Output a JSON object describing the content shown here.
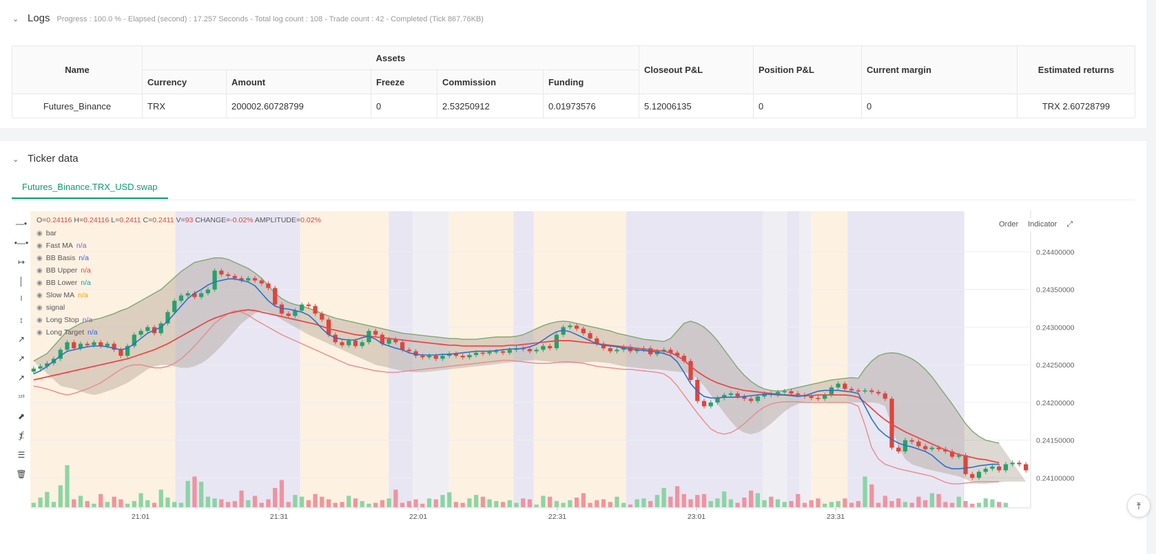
{
  "logs": {
    "title": "Logs",
    "progress": "Progress : 100.0 % - Elapsed (second) : 17.257  Seconds - Total log count : 108 - Trade count : 42 - Completed (Tick 867.76KB)"
  },
  "assets_table": {
    "headers": {
      "name": "Name",
      "assets": "Assets",
      "currency": "Currency",
      "amount": "Amount",
      "freeze": "Freeze",
      "commission": "Commission",
      "funding": "Funding",
      "closeout": "Closeout P&L",
      "position": "Position P&L",
      "margin": "Current margin",
      "returns": "Estimated returns"
    },
    "row": {
      "name": "Futures_Binance",
      "currency": "TRX",
      "amount": "200002.60728799",
      "freeze": "0",
      "commission": "2.53250912",
      "funding": "0.01973576",
      "closeout": "5.12006135",
      "position": "0",
      "margin": "0",
      "returns": "TRX 2.60728799"
    }
  },
  "ticker": {
    "title": "Ticker data",
    "tab": "Futures_Binance.TRX_USD.swap",
    "order_label": "Order",
    "indicator_label": "Indicator"
  },
  "legend": {
    "o_label": "O=",
    "o_val": "0.24116",
    "h_label": "H=",
    "h_val": "0.24116",
    "l_label": "L=",
    "l_val": "0.2411",
    "c_label": "C=",
    "c_val": "0.2411",
    "v_label": "V=",
    "v_val": "93",
    "chg_label": "CHANGE=",
    "chg_val": "-0.02%",
    "amp_label": "AMPLITUDE=",
    "amp_val": "0.02%",
    "items": [
      {
        "name": "bar",
        "value": "",
        "color": "#555"
      },
      {
        "name": "Fast MA",
        "value": "n/a",
        "color": "#7b61c9"
      },
      {
        "name": "BB Basis",
        "value": "n/a",
        "color": "#2962ff"
      },
      {
        "name": "BB Upper",
        "value": "n/a",
        "color": "#e0443c"
      },
      {
        "name": "BB Lower",
        "value": "n/a",
        "color": "#0aa59c"
      },
      {
        "name": "Slow MA",
        "value": "n/a",
        "color": "#f2a100"
      },
      {
        "name": "signal",
        "value": "",
        "color": "#555"
      },
      {
        "name": "Long Stop",
        "value": "n/a",
        "color": "#7b61c9"
      },
      {
        "name": "Long Target",
        "value": "n/a",
        "color": "#2962ff"
      }
    ]
  },
  "chart_data": {
    "type": "candlestick",
    "x_ticks": [
      "21:01",
      "21:31",
      "22:01",
      "22:31",
      "23:01",
      "23:31"
    ],
    "y_ticks": [
      "0.24400000",
      "0.24350000",
      "0.24300000",
      "0.24250000",
      "0.24200000",
      "0.24150000",
      "0.24100000"
    ],
    "y_tick_values": [
      0.244,
      0.2435,
      0.243,
      0.2425,
      0.242,
      0.2415,
      0.241
    ],
    "ylim": [
      0.24061,
      0.24452
    ],
    "colors": {
      "up": "#26a269",
      "down": "#e0443c",
      "fast_ma": "#2970c9",
      "slow_ma": "#e84848",
      "bb_upper": "#7fa86b",
      "bb_lower": "#e88a8a",
      "bb_fill": "#9e8f7e"
    },
    "close": [
      0.24245,
      0.24248,
      0.24252,
      0.24258,
      0.2427,
      0.2428,
      0.24272,
      0.24278,
      0.24276,
      0.2428,
      0.24275,
      0.24278,
      0.2427,
      0.24262,
      0.24275,
      0.2429,
      0.24295,
      0.243,
      0.24292,
      0.24305,
      0.2432,
      0.24335,
      0.24342,
      0.24345,
      0.2434,
      0.24345,
      0.2435,
      0.24375,
      0.2437,
      0.24368,
      0.24365,
      0.24362,
      0.24365,
      0.24362,
      0.24358,
      0.24352,
      0.2433,
      0.24318,
      0.24315,
      0.24322,
      0.2433,
      0.24328,
      0.24318,
      0.2431,
      0.2429,
      0.2428,
      0.24276,
      0.24282,
      0.24275,
      0.2428,
      0.24295,
      0.2429,
      0.24278,
      0.24284,
      0.2428,
      0.2427,
      0.24268,
      0.24262,
      0.2426,
      0.24262,
      0.24258,
      0.24262,
      0.24265,
      0.24262,
      0.2426,
      0.24263,
      0.24266,
      0.24265,
      0.24267,
      0.24268,
      0.24266,
      0.2427,
      0.24272,
      0.24271,
      0.24268,
      0.2427,
      0.24275,
      0.24272,
      0.2429,
      0.243,
      0.24302,
      0.24298,
      0.24292,
      0.24285,
      0.24278,
      0.24272,
      0.24268,
      0.2427,
      0.24274,
      0.24268,
      0.2427,
      0.24272,
      0.24264,
      0.24268,
      0.2427,
      0.24266,
      0.24262,
      0.24255,
      0.2423,
      0.24202,
      0.24195,
      0.242,
      0.24206,
      0.2421,
      0.24212,
      0.24208,
      0.24205,
      0.24202,
      0.24208,
      0.24212,
      0.2421,
      0.24214,
      0.24215,
      0.24212,
      0.2421,
      0.24208,
      0.24206,
      0.24205,
      0.2421,
      0.2422,
      0.24225,
      0.24218,
      0.24216,
      0.24215,
      0.24216,
      0.24214,
      0.24212,
      0.24205,
      0.2414,
      0.24135,
      0.2415,
      0.24148,
      0.24142,
      0.24138,
      0.2414,
      0.24138,
      0.24135,
      0.24128,
      0.2413,
      0.24105,
      0.241,
      0.24108,
      0.24112,
      0.24115,
      0.2411,
      0.24118,
      0.2412,
      0.24118,
      0.2411
    ],
    "fast_ma": [
      0.24238,
      0.24242,
      0.24248,
      0.24255,
      0.24262,
      0.24268,
      0.2427,
      0.24272,
      0.24274,
      0.24275,
      0.24275,
      0.24274,
      0.24272,
      0.2427,
      0.24272,
      0.24278,
      0.24285,
      0.24292,
      0.24296,
      0.243,
      0.24308,
      0.24318,
      0.24328,
      0.24338,
      0.24345,
      0.2435,
      0.24356,
      0.2436,
      0.24362,
      0.24364,
      0.24364,
      0.24362,
      0.2436,
      0.24355,
      0.24345,
      0.24335,
      0.24328,
      0.24325,
      0.24324,
      0.24322,
      0.2432,
      0.24316,
      0.24308,
      0.24298,
      0.2429,
      0.24286,
      0.24284,
      0.24283,
      0.24283,
      0.24286,
      0.24288,
      0.24284,
      0.24278,
      0.24275,
      0.24272,
      0.2427,
      0.24266,
      0.24264,
      0.24263,
      0.24263,
      0.24263,
      0.24264,
      0.24264,
      0.24265,
      0.24266,
      0.24267,
      0.24268,
      0.24268,
      0.24268,
      0.24269,
      0.2427,
      0.24271,
      0.24271,
      0.24272,
      0.24274,
      0.24277,
      0.24283,
      0.24289,
      0.24294,
      0.24296,
      0.24294,
      0.2429,
      0.24286,
      0.24282,
      0.24278,
      0.24276,
      0.24275,
      0.24274,
      0.24272,
      0.24271,
      0.2427,
      0.24269,
      0.24268,
      0.24267,
      0.24265,
      0.24262,
      0.24254,
      0.2424,
      0.24225,
      0.24215,
      0.24208,
      0.24206,
      0.24206,
      0.24207,
      0.24207,
      0.24207,
      0.24208,
      0.24209,
      0.2421,
      0.24211,
      0.24211,
      0.2421,
      0.2421,
      0.24209,
      0.24208,
      0.24209,
      0.24212,
      0.24215,
      0.24216,
      0.24216,
      0.24216,
      0.24215,
      0.24214,
      0.24212,
      0.24195,
      0.24178,
      0.24165,
      0.24157,
      0.24151,
      0.24146,
      0.24143,
      0.24141,
      0.24138,
      0.24135,
      0.2413,
      0.24122,
      0.24115,
      0.24112,
      0.24112,
      0.24113,
      0.24114,
      0.24116,
      0.24117,
      0.24118,
      0.24118
    ],
    "slow_ma": [
      0.2423,
      0.24232,
      0.24234,
      0.24236,
      0.24238,
      0.2424,
      0.24242,
      0.24244,
      0.24246,
      0.24248,
      0.2425,
      0.24252,
      0.24254,
      0.24256,
      0.24258,
      0.24261,
      0.24264,
      0.24267,
      0.2427,
      0.24274,
      0.24278,
      0.24283,
      0.24288,
      0.24293,
      0.24298,
      0.24303,
      0.24308,
      0.24312,
      0.24315,
      0.24318,
      0.2432,
      0.24322,
      0.24323,
      0.24322,
      0.2432,
      0.24318,
      0.24316,
      0.24314,
      0.24312,
      0.2431,
      0.24308,
      0.24306,
      0.24304,
      0.24301,
      0.24298,
      0.24296,
      0.24294,
      0.24292,
      0.2429,
      0.24289,
      0.24288,
      0.24287,
      0.24286,
      0.24285,
      0.24284,
      0.24283,
      0.24282,
      0.24281,
      0.2428,
      0.24279,
      0.24278,
      0.24277,
      0.24276,
      0.24276,
      0.24275,
      0.24275,
      0.24275,
      0.24275,
      0.24275,
      0.24275,
      0.24275,
      0.24276,
      0.24276,
      0.24277,
      0.24278,
      0.24279,
      0.2428,
      0.24281,
      0.24282,
      0.24282,
      0.24282,
      0.24281,
      0.2428,
      0.24279,
      0.24278,
      0.24277,
      0.24276,
      0.24275,
      0.24274,
      0.24273,
      0.24272,
      0.24271,
      0.2427,
      0.24269,
      0.24268,
      0.24266,
      0.24262,
      0.24256,
      0.24248,
      0.24241,
      0.24235,
      0.2423,
      0.24226,
      0.24223,
      0.2422,
      0.24218,
      0.24216,
      0.24215,
      0.24214,
      0.24213,
      0.24212,
      0.24211,
      0.2421,
      0.2421,
      0.24209,
      0.24209,
      0.24209,
      0.2421,
      0.2421,
      0.2421,
      0.2421,
      0.2421,
      0.24209,
      0.24207,
      0.242,
      0.24192,
      0.24184,
      0.24177,
      0.24171,
      0.24166,
      0.24161,
      0.24157,
      0.24153,
      0.24149,
      0.24145,
      0.24141,
      0.24137,
      0.24134,
      0.24131,
      0.24129,
      0.24127,
      0.24125,
      0.24124,
      0.24122,
      0.2412
    ],
    "bb_upper": [
      0.24255,
      0.2426,
      0.24265,
      0.24275,
      0.24285,
      0.24295,
      0.243,
      0.24305,
      0.24308,
      0.2431,
      0.24312,
      0.24315,
      0.24318,
      0.24322,
      0.24325,
      0.2433,
      0.24335,
      0.2434,
      0.24345,
      0.2435,
      0.24358,
      0.24366,
      0.24374,
      0.2438,
      0.24386,
      0.24388,
      0.2439,
      0.24392,
      0.24392,
      0.2439,
      0.24386,
      0.24382,
      0.24378,
      0.24372,
      0.24365,
      0.24355,
      0.24345,
      0.24338,
      0.24333,
      0.2433,
      0.24328,
      0.24325,
      0.24322,
      0.24318,
      0.24315,
      0.24312,
      0.2431,
      0.24308,
      0.24306,
      0.24304,
      0.24302,
      0.243,
      0.24298,
      0.24296,
      0.24294,
      0.24292,
      0.24291,
      0.2429,
      0.24289,
      0.24288,
      0.24287,
      0.24286,
      0.24285,
      0.24285,
      0.24284,
      0.24284,
      0.24284,
      0.24285,
      0.24286,
      0.24287,
      0.24287,
      0.24287,
      0.24288,
      0.2429,
      0.24294,
      0.24298,
      0.24302,
      0.24305,
      0.24307,
      0.24308,
      0.24307,
      0.24305,
      0.24303,
      0.24301,
      0.24299,
      0.24297,
      0.24295,
      0.24292,
      0.2429,
      0.24288,
      0.24286,
      0.24284,
      0.24283,
      0.24282,
      0.24281,
      0.24285,
      0.24295,
      0.24305,
      0.24308,
      0.24305,
      0.243,
      0.24292,
      0.24282,
      0.2427,
      0.24258,
      0.24246,
      0.24236,
      0.24228,
      0.24222,
      0.24218,
      0.24216,
      0.24215,
      0.24216,
      0.24218,
      0.2422,
      0.24222,
      0.24224,
      0.24226,
      0.24228,
      0.2423,
      0.24231,
      0.24232,
      0.24233,
      0.24232,
      0.24245,
      0.24255,
      0.24262,
      0.24265,
      0.24266,
      0.24265,
      0.24262,
      0.24258,
      0.24252,
      0.24244,
      0.24234,
      0.24222,
      0.2421,
      0.24198,
      0.24185,
      0.24172,
      0.24162,
      0.24155,
      0.2415,
      0.24148,
      0.24146
    ],
    "bb_lower": [
      0.24222,
      0.2422,
      0.24218,
      0.24215,
      0.24212,
      0.2421,
      0.24212,
      0.24215,
      0.24218,
      0.24222,
      0.24226,
      0.24232,
      0.24238,
      0.24244,
      0.24248,
      0.2425,
      0.2425,
      0.24248,
      0.24246,
      0.24246,
      0.24248,
      0.24252,
      0.24258,
      0.24266,
      0.24275,
      0.24285,
      0.24295,
      0.24305,
      0.24312,
      0.24318,
      0.24322,
      0.2432,
      0.24316,
      0.2431,
      0.24305,
      0.243,
      0.24295,
      0.2429,
      0.24286,
      0.24282,
      0.24278,
      0.24274,
      0.2427,
      0.24266,
      0.24262,
      0.24258,
      0.24254,
      0.2425,
      0.24248,
      0.24246,
      0.24244,
      0.24242,
      0.24241,
      0.2424,
      0.2424,
      0.24241,
      0.24242,
      0.24243,
      0.24244,
      0.24245,
      0.24246,
      0.24247,
      0.24248,
      0.24249,
      0.2425,
      0.24251,
      0.24252,
      0.24253,
      0.24254,
      0.24255,
      0.24256,
      0.24256,
      0.24255,
      0.24254,
      0.24253,
      0.24252,
      0.24252,
      0.24252,
      0.24253,
      0.24254,
      0.24254,
      0.24253,
      0.24252,
      0.2425,
      0.24248,
      0.24247,
      0.24246,
      0.24245,
      0.24244,
      0.24244,
      0.24243,
      0.24242,
      0.24241,
      0.2424,
      0.24238,
      0.24232,
      0.24222,
      0.2421,
      0.24198,
      0.24186,
      0.24175,
      0.24165,
      0.2416,
      0.24158,
      0.2416,
      0.24165,
      0.24172,
      0.2418,
      0.24188,
      0.24194,
      0.24198,
      0.242,
      0.24201,
      0.24201,
      0.24201,
      0.242,
      0.242,
      0.242,
      0.242,
      0.242,
      0.242,
      0.242,
      0.24199,
      0.24195,
      0.2417,
      0.2414,
      0.24125,
      0.24118,
      0.24115,
      0.24112,
      0.2411,
      0.24108,
      0.24106,
      0.24104,
      0.24102,
      0.24098,
      0.24094,
      0.24092,
      0.24092,
      0.24093,
      0.24094,
      0.24095,
      0.24095,
      0.24095,
      0.24095
    ],
    "volume": [
      10,
      22,
      35,
      12,
      50,
      96,
      18,
      26,
      14,
      8,
      30,
      12,
      24,
      18,
      8,
      14,
      32,
      16,
      10,
      40,
      22,
      12,
      10,
      60,
      70,
      58,
      24,
      20,
      18,
      12,
      14,
      38,
      16,
      26,
      10,
      18,
      44,
      62,
      12,
      28,
      24,
      16,
      30,
      24,
      18,
      10,
      12,
      26,
      20,
      14,
      8,
      10,
      16,
      20,
      40,
      10,
      14,
      18,
      8,
      20,
      18,
      28,
      34,
      12,
      10,
      20,
      28,
      24,
      18,
      14,
      12,
      16,
      10,
      20,
      18,
      6,
      26,
      24,
      14,
      10,
      16,
      22,
      32,
      10,
      16,
      18,
      12,
      24,
      10,
      6,
      18,
      20,
      14,
      28,
      44,
      24,
      48,
      30,
      18,
      28,
      30,
      14,
      20,
      36,
      18,
      10,
      22,
      38,
      32,
      16,
      24,
      18,
      12,
      14,
      30,
      10,
      16,
      20,
      8,
      12,
      14,
      20,
      10,
      14,
      70,
      52,
      10,
      26,
      14,
      20,
      12,
      10,
      24,
      16,
      32,
      30,
      12,
      10,
      24,
      14,
      8,
      10,
      20,
      18,
      12,
      10
    ]
  }
}
